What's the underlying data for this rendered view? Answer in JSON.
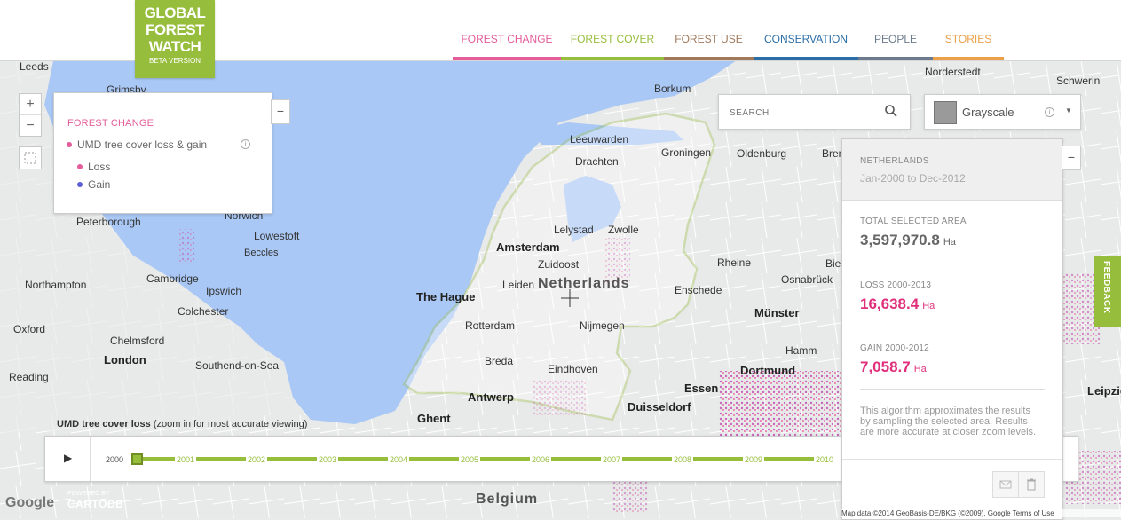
{
  "logo": {
    "line1": "GLOBAL",
    "line2": "FOREST",
    "line3": "WATCH",
    "line4": "BETA VERSION"
  },
  "nav": [
    {
      "label": "FOREST CHANGE",
      "color": "#e45c9a"
    },
    {
      "label": "FOREST COVER",
      "color": "#97bd3d"
    },
    {
      "label": "FOREST USE",
      "color": "#a0785a"
    },
    {
      "label": "CONSERVATION",
      "color": "#2b6ea6"
    },
    {
      "label": "PEOPLE",
      "color": "#6b7b8c"
    },
    {
      "label": "STORIES",
      "color": "#eaa149"
    }
  ],
  "zoom": {
    "in": "+",
    "out": "−"
  },
  "layer_panel": {
    "title": "FOREST CHANGE",
    "layer": "UMD tree cover loss & gain",
    "loss": "Loss",
    "gain": "Gain",
    "minimize": "−",
    "loss_color": "#e45c9a",
    "gain_color": "#5b5bd6"
  },
  "search": {
    "placeholder": "SEARCH",
    "icon": "search-icon"
  },
  "basemap": {
    "label": "Grayscale"
  },
  "stats": {
    "country": "NETHERLANDS",
    "period": "Jan-2000 to Dec-2012",
    "area_label": "TOTAL SELECTED AREA",
    "area_value": "3,597,970.8",
    "loss_label": "LOSS 2000-2013",
    "loss_value": "16,638.4",
    "gain_label": "GAIN 2000-2012",
    "gain_value": "7,058.7",
    "unit": "Ha",
    "note": "This algorithm approximates the results by sampling the selected area. Results are more accurate at closer zoom levels.",
    "minimize": "−"
  },
  "feedback": "FEEDBACK",
  "timeline": {
    "play": "▶",
    "years": [
      "2000",
      "2001",
      "2002",
      "2003",
      "2004",
      "2005",
      "2006",
      "2007",
      "2008",
      "2009",
      "2010"
    ]
  },
  "caption": {
    "bold": "UMD tree cover loss",
    "rest": " (zoom in for most accurate viewing)"
  },
  "branding": {
    "google": "Google",
    "powered": "POWERED BY",
    "cartodb": "CARTODB"
  },
  "attribution": "Map data ©2014 GeoBasis-DE/BKG (©2009), Google   Terms of Use",
  "map": {
    "countries": [
      "Netherlands",
      "Belgium"
    ],
    "cities": [
      "Leeds",
      "Grimsby",
      "Peterborough",
      "Norwich",
      "Lowestoft",
      "Beccles",
      "Cambridge",
      "Ipswich",
      "Northampton",
      "Colchester",
      "Chelmsford",
      "Oxford",
      "London",
      "Southend-on-Sea",
      "Reading",
      "Leeuwarden",
      "Groningen",
      "Drachten",
      "Lelystad",
      "Zwolle",
      "Amsterdam",
      "Zuidoost",
      "Leiden",
      "The Hague",
      "Rotterdam",
      "Nijmegen",
      "Breda",
      "Eindhoven",
      "Antwerp",
      "Ghent",
      "Duisseldorf",
      "Essen",
      "Dortmund",
      "Münster",
      "Oldenburg",
      "Bremen",
      "Hamm",
      "Bielefeld",
      "Rheine",
      "Osnabrück",
      "Enschede",
      "Norderstedt",
      "Schwerin",
      "Borkum",
      "Leipzig"
    ]
  }
}
